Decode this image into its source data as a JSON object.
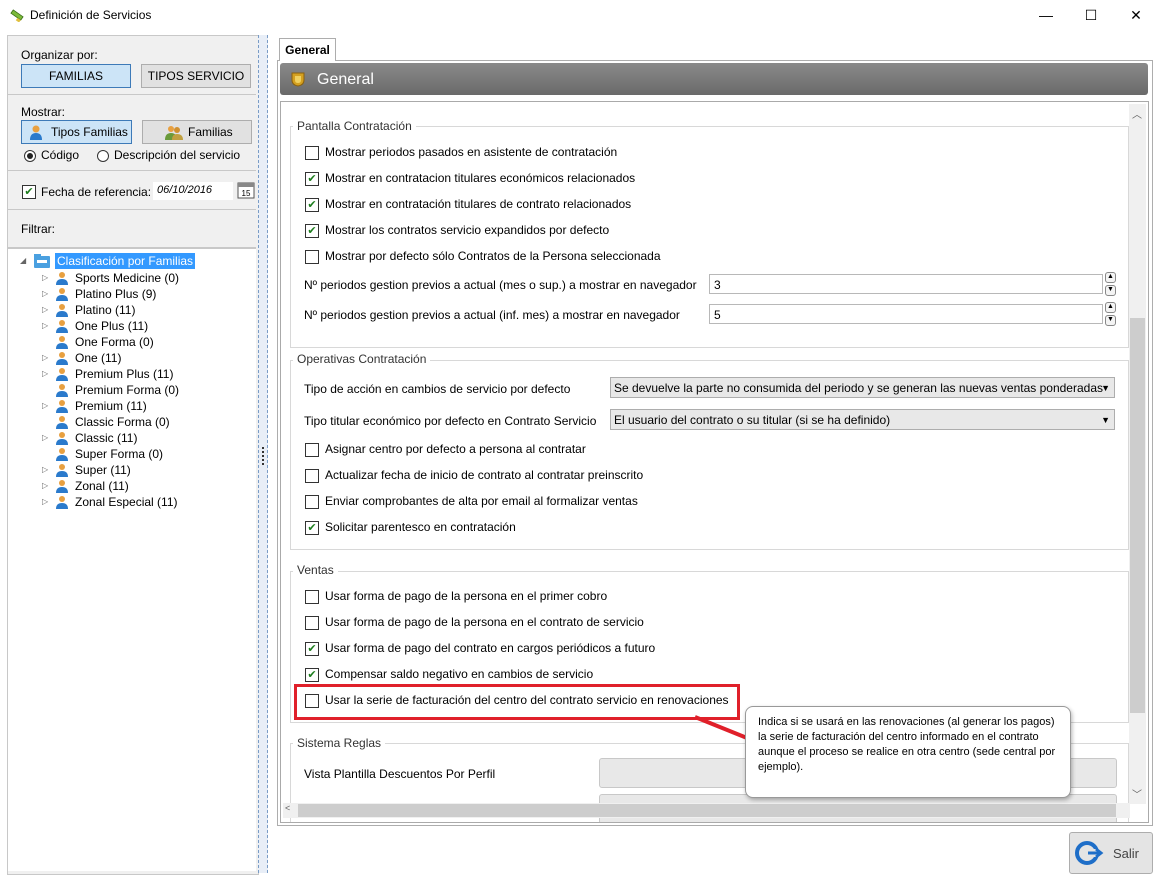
{
  "window": {
    "title": "Definición de Servicios",
    "minimize": "—",
    "maximize": "☐",
    "close": "✕"
  },
  "left": {
    "organizar_label": "Organizar por:",
    "btn_familias": "FAMILIAS",
    "btn_tipos_servicio": "TIPOS SERVICIO",
    "mostrar_label": "Mostrar:",
    "btn_tipos_familias": "Tipos Familias",
    "btn_familias2": "Familias",
    "radio_codigo": "Código",
    "radio_descripcion": "Descripción del servicio",
    "fecha_label": "Fecha de referencia:",
    "fecha_value": "06/10/2016",
    "filtrar_label": "Filtrar:",
    "tree_root": "Clasificación por Familias",
    "tree_items": [
      {
        "label": "Sports Medicine (0)",
        "expandable": true
      },
      {
        "label": "Platino Plus (9)",
        "expandable": true
      },
      {
        "label": "Platino (11)",
        "expandable": true
      },
      {
        "label": "One Plus (11)",
        "expandable": true
      },
      {
        "label": "One Forma (0)",
        "expandable": false
      },
      {
        "label": "One (11)",
        "expandable": true
      },
      {
        "label": "Premium Plus (11)",
        "expandable": true
      },
      {
        "label": "Premium Forma (0)",
        "expandable": false
      },
      {
        "label": "Premium (11)",
        "expandable": true
      },
      {
        "label": "Classic Forma (0)",
        "expandable": false
      },
      {
        "label": "Classic (11)",
        "expandable": true
      },
      {
        "label": "Super Forma (0)",
        "expandable": false
      },
      {
        "label": "Super (11)",
        "expandable": true
      },
      {
        "label": "Zonal (11)",
        "expandable": true
      },
      {
        "label": "Zonal Especial (11)",
        "expandable": true
      }
    ]
  },
  "right": {
    "tab": "General",
    "header": "General",
    "pantalla": {
      "title": "Pantalla Contratación",
      "checks": [
        {
          "label": "Mostrar periodos pasados en asistente de contratación",
          "checked": false
        },
        {
          "label": "Mostrar en contratacion titulares económicos relacionados",
          "checked": true
        },
        {
          "label": "Mostrar en contratación titulares de contrato relacionados",
          "checked": true
        },
        {
          "label": "Mostrar los contratos servicio expandidos por defecto",
          "checked": true
        },
        {
          "label": "Mostrar por defecto sólo Contratos de la Persona seleccionada",
          "checked": false
        }
      ],
      "np1_label": "Nº periodos gestion previos a actual (mes o sup.) a mostrar en navegador",
      "np1_value": "3",
      "np2_label": "Nº periodos gestion previos a actual (inf. mes) a mostrar en navegador",
      "np2_value": "5"
    },
    "operativas": {
      "title": "Operativas Contratación",
      "tipo_accion_label": "Tipo de acción en cambios de servicio por defecto",
      "tipo_accion_value": "Se devuelve la parte no consumida del periodo y se generan las nuevas ventas ponderadas",
      "tipo_titular_label": "Tipo titular económico por defecto en Contrato Servicio",
      "tipo_titular_value": "El usuario del contrato o su titular (si se ha definido)",
      "checks": [
        {
          "label": "Asignar centro por defecto a persona al contratar",
          "checked": false
        },
        {
          "label": "Actualizar fecha de inicio de contrato al contratar preinscrito",
          "checked": false
        },
        {
          "label": "Enviar comprobantes de alta por email al formalizar ventas",
          "checked": false
        },
        {
          "label": "Solicitar parentesco en contratación",
          "checked": true
        }
      ]
    },
    "ventas": {
      "title": "Ventas",
      "checks": [
        {
          "label": "Usar forma de pago de la persona en el primer cobro",
          "checked": false
        },
        {
          "label": "Usar forma de pago de la persona en el contrato de servicio",
          "checked": false
        },
        {
          "label": "Usar forma de pago del contrato en cargos periódicos a futuro",
          "checked": true
        },
        {
          "label": "Compensar saldo negativo en cambios de servicio",
          "checked": true
        },
        {
          "label": "Usar la serie de facturación del centro del contrato servicio en renovaciones",
          "checked": false
        }
      ]
    },
    "sistema": {
      "title": "Sistema Reglas",
      "vista_label": "Vista Plantilla Descuentos Por Perfil"
    },
    "tooltip": "Indica si se usará en las renovaciones (al generar los pagos) la serie de facturación del centro informado en el contrato aunque el proceso se realice en otra centro (sede central por ejemplo).",
    "salir": "Salir"
  }
}
